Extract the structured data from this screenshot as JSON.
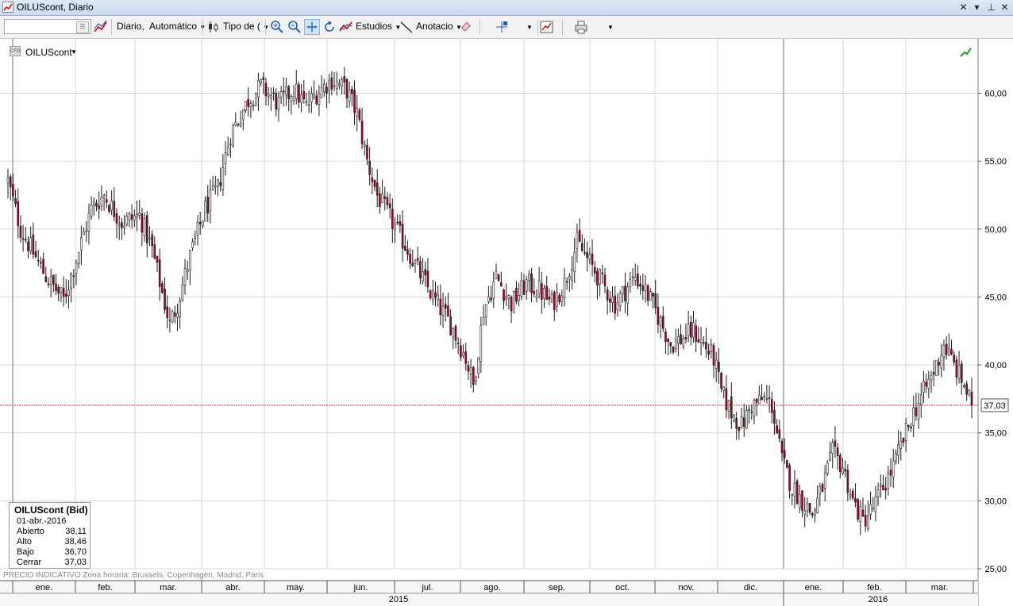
{
  "window": {
    "title": "OILUScont, Diario"
  },
  "toolbar": {
    "symbol_value": "",
    "period_label": "Diario,",
    "scale_label": "Automático",
    "chart_type_label": "Tipo de (",
    "studies_label": "Estudios",
    "annotation_label": "Anotacio"
  },
  "legend": {
    "instrument": "OILUScont"
  },
  "infobox": {
    "title": "OILUScont (Bid)",
    "date": "01-abr.-2016",
    "rows": [
      {
        "label": "Abierto",
        "value": "38,11"
      },
      {
        "label": "Alto",
        "value": "38,46"
      },
      {
        "label": "Bajo",
        "value": "36,70"
      },
      {
        "label": "Cerrar",
        "value": "37,03"
      }
    ]
  },
  "status": {
    "note": "PRECIO INDICATIVO   Zona horaria: Brussels, Copenhagen, Madrid, Paris"
  },
  "colors": {
    "up": "#ffffff",
    "down": "#a50021",
    "wick": "#1a1a1a",
    "grid": "#d6d6d6",
    "last_price_line": "#cc3333"
  },
  "chart_data": {
    "type": "candlestick",
    "instrument": "OILUScont",
    "ylim": [
      25,
      64
    ],
    "y_ticks": [
      "25,00",
      "30,00",
      "35,00",
      "40,00",
      "45,00",
      "50,00",
      "55,00",
      "60,00"
    ],
    "y_tick_values": [
      25,
      30,
      35,
      40,
      45,
      50,
      55,
      60
    ],
    "month_labels": [
      "ene.",
      "feb.",
      "mar.",
      "abr.",
      "may.",
      "jun.",
      "jul.",
      "ago.",
      "sep.",
      "oct.",
      "nov.",
      "dic.",
      "ene.",
      "feb.",
      "mar."
    ],
    "year_labels": [
      "2015",
      "2016"
    ],
    "last_price": 37.03,
    "last_price_label": "37,03",
    "close_waypoints": [
      [
        0,
        53.5
      ],
      [
        5,
        50.0
      ],
      [
        15,
        46.5
      ],
      [
        22,
        44.8
      ],
      [
        27,
        47.8
      ],
      [
        33,
        51.5
      ],
      [
        38,
        52.5
      ],
      [
        45,
        50.5
      ],
      [
        52,
        51.0
      ],
      [
        57,
        48.5
      ],
      [
        62,
        44.5
      ],
      [
        64,
        43.0
      ],
      [
        67,
        44.5
      ],
      [
        72,
        48.0
      ],
      [
        78,
        51.5
      ],
      [
        83,
        53.0
      ],
      [
        88,
        57.0
      ],
      [
        95,
        59.5
      ],
      [
        100,
        60.5
      ],
      [
        107,
        59.2
      ],
      [
        113,
        60.3
      ],
      [
        118,
        59.0
      ],
      [
        122,
        60.0
      ],
      [
        128,
        61.0
      ],
      [
        134,
        60.2
      ],
      [
        138,
        58.5
      ],
      [
        142,
        55.0
      ],
      [
        146,
        52.5
      ],
      [
        152,
        50.5
      ],
      [
        158,
        48.5
      ],
      [
        162,
        47.0
      ],
      [
        168,
        45.0
      ],
      [
        175,
        43.0
      ],
      [
        181,
        40.5
      ],
      [
        184,
        38.5
      ],
      [
        188,
        44.0
      ],
      [
        193,
        46.5
      ],
      [
        199,
        44.5
      ],
      [
        205,
        46.0
      ],
      [
        210,
        45.5
      ],
      [
        215,
        44.5
      ],
      [
        220,
        46.0
      ],
      [
        225,
        49.0
      ],
      [
        230,
        47.5
      ],
      [
        235,
        46.0
      ],
      [
        240,
        44.5
      ],
      [
        244,
        45.5
      ],
      [
        248,
        46.5
      ],
      [
        252,
        45.5
      ],
      [
        256,
        44.0
      ],
      [
        262,
        41.5
      ],
      [
        267,
        42.0
      ],
      [
        271,
        42.5
      ],
      [
        275,
        41.5
      ],
      [
        279,
        40.5
      ],
      [
        282,
        38.0
      ],
      [
        286,
        36.5
      ],
      [
        290,
        35.5
      ],
      [
        294,
        37.0
      ],
      [
        299,
        37.5
      ],
      [
        302,
        37.0
      ],
      [
        306,
        33.0
      ],
      [
        310,
        31.0
      ],
      [
        314,
        30.0
      ],
      [
        318,
        29.0
      ],
      [
        322,
        31.0
      ],
      [
        326,
        33.5
      ],
      [
        330,
        32.5
      ],
      [
        334,
        30.0
      ],
      [
        338,
        28.5
      ],
      [
        342,
        29.5
      ],
      [
        346,
        31.0
      ],
      [
        350,
        32.5
      ],
      [
        354,
        34.5
      ],
      [
        358,
        36.5
      ],
      [
        362,
        38.0
      ],
      [
        366,
        39.5
      ],
      [
        370,
        41.5
      ],
      [
        374,
        40.0
      ],
      [
        378,
        38.5
      ],
      [
        381,
        37.03
      ]
    ]
  }
}
